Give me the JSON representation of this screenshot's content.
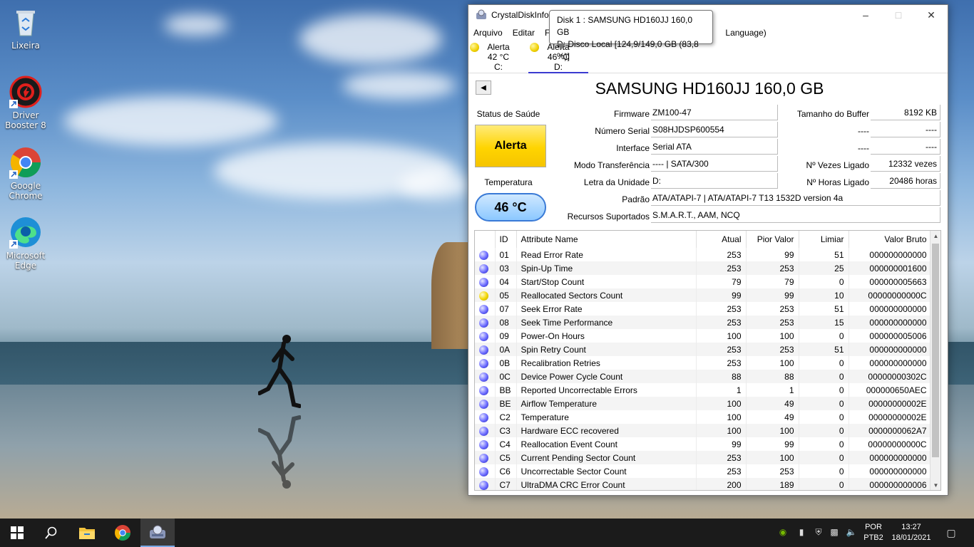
{
  "desktop": {
    "icons": [
      {
        "label": "Lixeira"
      },
      {
        "label": "Driver Booster 8"
      },
      {
        "label": "Google Chrome"
      },
      {
        "label": "Microsoft Edge"
      }
    ]
  },
  "window": {
    "title": "CrystalDiskInfo 8",
    "menu": [
      "Arquivo",
      "Editar",
      "F",
      "Language)"
    ],
    "disks": [
      {
        "status": "Alerta",
        "temp": "42 °C",
        "drive": "C:"
      },
      {
        "status": "Alerta",
        "temp": "46 °C",
        "drive": "D:"
      }
    ],
    "tooltip": {
      "line1": "Disk 1 : SAMSUNG HD160JJ 160,0 GB",
      "line2": "D: Disco Local [124,9/149,0 GB (83,8 %)]"
    },
    "disk_title": "SAMSUNG HD160JJ 160,0 GB",
    "health_label": "Status de Saúde",
    "health_value": "Alerta",
    "temp_label": "Temperatura",
    "temp_value": "46 °C",
    "info": {
      "firmware_label": "Firmware",
      "firmware": "ZM100-47",
      "serial_label": "Número Serial",
      "serial": "S08HJDSP600554",
      "interface_label": "Interface",
      "interface": "Serial ATA",
      "transfer_label": "Modo Transferência",
      "transfer": "---- | SATA/300",
      "drive_letter_label": "Letra da Unidade",
      "drive_letter": "D:",
      "standard_label": "Padrão",
      "standard": "ATA/ATAPI-7 | ATA/ATAPI-7 T13 1532D version 4a",
      "features_label": "Recursos Suportados",
      "features": "S.M.A.R.T., AAM, NCQ",
      "buffer_label": "Tamanho do Buffer",
      "buffer": "8192 KB",
      "blank1_label": "----",
      "blank1": "----",
      "blank2_label": "----",
      "blank2": "----",
      "power_on_count_label": "Nº Vezes Ligado",
      "power_on_count": "12332 vezes",
      "power_on_hours_label": "Nº Horas Ligado",
      "power_on_hours": "20486 horas"
    },
    "smart": {
      "columns": [
        "ID",
        "Attribute Name",
        "Atual",
        "Pior Valor",
        "Limiar",
        "Valor Bruto"
      ],
      "rows": [
        {
          "status": "good",
          "id": "01",
          "name": "Read Error Rate",
          "cur": "253",
          "worst": "99",
          "thr": "51",
          "raw": "000000000000"
        },
        {
          "status": "good",
          "id": "03",
          "name": "Spin-Up Time",
          "cur": "253",
          "worst": "253",
          "thr": "25",
          "raw": "000000001600"
        },
        {
          "status": "good",
          "id": "04",
          "name": "Start/Stop Count",
          "cur": "79",
          "worst": "79",
          "thr": "0",
          "raw": "000000005663"
        },
        {
          "status": "warn",
          "id": "05",
          "name": "Reallocated Sectors Count",
          "cur": "99",
          "worst": "99",
          "thr": "10",
          "raw": "00000000000C"
        },
        {
          "status": "good",
          "id": "07",
          "name": "Seek Error Rate",
          "cur": "253",
          "worst": "253",
          "thr": "51",
          "raw": "000000000000"
        },
        {
          "status": "good",
          "id": "08",
          "name": "Seek Time Performance",
          "cur": "253",
          "worst": "253",
          "thr": "15",
          "raw": "000000000000"
        },
        {
          "status": "good",
          "id": "09",
          "name": "Power-On Hours",
          "cur": "100",
          "worst": "100",
          "thr": "0",
          "raw": "000000005006"
        },
        {
          "status": "good",
          "id": "0A",
          "name": "Spin Retry Count",
          "cur": "253",
          "worst": "253",
          "thr": "51",
          "raw": "000000000000"
        },
        {
          "status": "good",
          "id": "0B",
          "name": "Recalibration Retries",
          "cur": "253",
          "worst": "100",
          "thr": "0",
          "raw": "000000000000"
        },
        {
          "status": "good",
          "id": "0C",
          "name": "Device Power Cycle Count",
          "cur": "88",
          "worst": "88",
          "thr": "0",
          "raw": "00000000302C"
        },
        {
          "status": "good",
          "id": "BB",
          "name": "Reported Uncorrectable Errors",
          "cur": "1",
          "worst": "1",
          "thr": "0",
          "raw": "000000650AEC"
        },
        {
          "status": "good",
          "id": "BE",
          "name": "Airflow Temperature",
          "cur": "100",
          "worst": "49",
          "thr": "0",
          "raw": "00000000002E"
        },
        {
          "status": "good",
          "id": "C2",
          "name": "Temperature",
          "cur": "100",
          "worst": "49",
          "thr": "0",
          "raw": "00000000002E"
        },
        {
          "status": "good",
          "id": "C3",
          "name": "Hardware ECC recovered",
          "cur": "100",
          "worst": "100",
          "thr": "0",
          "raw": "0000000062A7"
        },
        {
          "status": "good",
          "id": "C4",
          "name": "Reallocation Event Count",
          "cur": "99",
          "worst": "99",
          "thr": "0",
          "raw": "00000000000C"
        },
        {
          "status": "good",
          "id": "C5",
          "name": "Current Pending Sector Count",
          "cur": "253",
          "worst": "100",
          "thr": "0",
          "raw": "000000000000"
        },
        {
          "status": "good",
          "id": "C6",
          "name": "Uncorrectable Sector Count",
          "cur": "253",
          "worst": "253",
          "thr": "0",
          "raw": "000000000000"
        },
        {
          "status": "good",
          "id": "C7",
          "name": "UltraDMA CRC Error Count",
          "cur": "200",
          "worst": "189",
          "thr": "0",
          "raw": "000000000006"
        }
      ]
    }
  },
  "taskbar": {
    "lang_top": "POR",
    "lang_bottom": "PTB2",
    "time": "13:27",
    "date": "18/01/2021"
  },
  "icons": [
    "recycle-bin-icon",
    "driver-booster-icon",
    "chrome-icon",
    "edge-icon",
    "start-icon",
    "search-icon",
    "file-explorer-icon",
    "crystaldiskinfo-icon",
    "nvidia-icon",
    "usb-icon",
    "shield-icon",
    "network-icon",
    "volume-icon",
    "notification-icon"
  ],
  "colors": {
    "alert": "#ffd400",
    "good": "#4a4aff",
    "temp_border": "#3a7ad6",
    "taskbar": "#1b1b1b"
  }
}
